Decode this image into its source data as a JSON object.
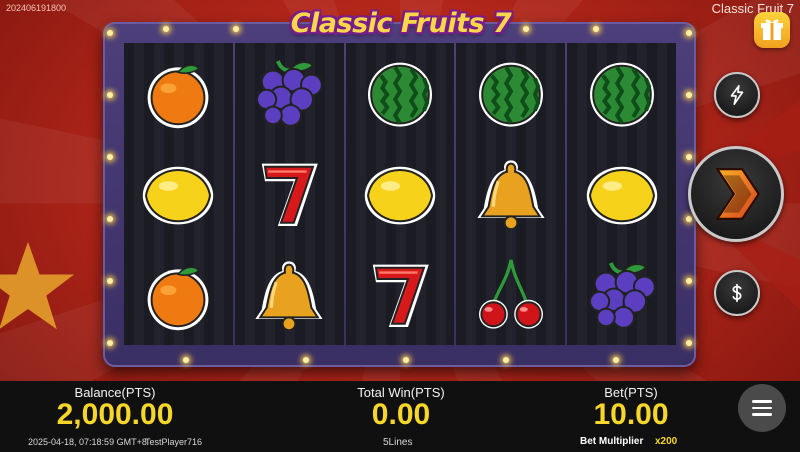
{
  "header": {
    "session_id": "20240619180​0",
    "game_title": "Classic Fruit 7",
    "logo_text": "Classic Fruits 7"
  },
  "reels": [
    [
      "orange",
      "lemon",
      "orange"
    ],
    [
      "grapes",
      "seven",
      "bell"
    ],
    [
      "watermelon",
      "lemon",
      "seven"
    ],
    [
      "watermelon",
      "bell",
      "cherry"
    ],
    [
      "watermelon",
      "lemon",
      "grapes"
    ]
  ],
  "side_buttons": {
    "turbo_icon": "lightning-icon",
    "spin_icon": "spin-chevron-icon",
    "bet_icon": "dollar-icon"
  },
  "stats": {
    "balance_label": "Balance(PTS)",
    "balance_value": "2,000.00",
    "total_win_label": "Total Win(PTS)",
    "total_win_value": "0.00",
    "bet_label": "Bet(PTS)",
    "bet_value": "10.00"
  },
  "footer": {
    "datetime": "2025-04-18, 07:18:59 GMT+8",
    "player": "TestPlayer716",
    "lines": "5Lines",
    "bet_multiplier_label": "Bet Multiplier",
    "bet_multiplier_value": "x200"
  },
  "colors": {
    "accent_yellow": "#f7d62a",
    "background_red": "#b3261a",
    "frame_purple": "#4d3f7b"
  }
}
